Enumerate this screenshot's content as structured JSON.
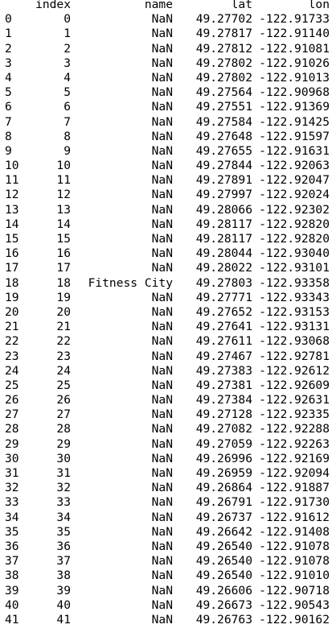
{
  "columns": [
    "index",
    "name",
    "lat",
    "lon"
  ],
  "rows": [
    [
      "0",
      "0",
      "NaN",
      "49.27702",
      "-122.91733"
    ],
    [
      "1",
      "1",
      "NaN",
      "49.27817",
      "-122.91140"
    ],
    [
      "2",
      "2",
      "NaN",
      "49.27812",
      "-122.91081"
    ],
    [
      "3",
      "3",
      "NaN",
      "49.27802",
      "-122.91026"
    ],
    [
      "4",
      "4",
      "NaN",
      "49.27802",
      "-122.91013"
    ],
    [
      "5",
      "5",
      "NaN",
      "49.27564",
      "-122.90968"
    ],
    [
      "6",
      "6",
      "NaN",
      "49.27551",
      "-122.91369"
    ],
    [
      "7",
      "7",
      "NaN",
      "49.27584",
      "-122.91425"
    ],
    [
      "8",
      "8",
      "NaN",
      "49.27648",
      "-122.91597"
    ],
    [
      "9",
      "9",
      "NaN",
      "49.27655",
      "-122.91631"
    ],
    [
      "10",
      "10",
      "NaN",
      "49.27844",
      "-122.92063"
    ],
    [
      "11",
      "11",
      "NaN",
      "49.27891",
      "-122.92047"
    ],
    [
      "12",
      "12",
      "NaN",
      "49.27997",
      "-122.92024"
    ],
    [
      "13",
      "13",
      "NaN",
      "49.28066",
      "-122.92302"
    ],
    [
      "14",
      "14",
      "NaN",
      "49.28117",
      "-122.92820"
    ],
    [
      "15",
      "15",
      "NaN",
      "49.28117",
      "-122.92820"
    ],
    [
      "16",
      "16",
      "NaN",
      "49.28044",
      "-122.93040"
    ],
    [
      "17",
      "17",
      "NaN",
      "49.28022",
      "-122.93101"
    ],
    [
      "18",
      "18",
      "Fitness City",
      "49.27803",
      "-122.93358"
    ],
    [
      "19",
      "19",
      "NaN",
      "49.27771",
      "-122.93343"
    ],
    [
      "20",
      "20",
      "NaN",
      "49.27652",
      "-122.93153"
    ],
    [
      "21",
      "21",
      "NaN",
      "49.27641",
      "-122.93131"
    ],
    [
      "22",
      "22",
      "NaN",
      "49.27611",
      "-122.93068"
    ],
    [
      "23",
      "23",
      "NaN",
      "49.27467",
      "-122.92781"
    ],
    [
      "24",
      "24",
      "NaN",
      "49.27383",
      "-122.92612"
    ],
    [
      "25",
      "25",
      "NaN",
      "49.27381",
      "-122.92609"
    ],
    [
      "26",
      "26",
      "NaN",
      "49.27384",
      "-122.92631"
    ],
    [
      "27",
      "27",
      "NaN",
      "49.27128",
      "-122.92335"
    ],
    [
      "28",
      "28",
      "NaN",
      "49.27082",
      "-122.92288"
    ],
    [
      "29",
      "29",
      "NaN",
      "49.27059",
      "-122.92263"
    ],
    [
      "30",
      "30",
      "NaN",
      "49.26996",
      "-122.92169"
    ],
    [
      "31",
      "31",
      "NaN",
      "49.26959",
      "-122.92094"
    ],
    [
      "32",
      "32",
      "NaN",
      "49.26864",
      "-122.91887"
    ],
    [
      "33",
      "33",
      "NaN",
      "49.26791",
      "-122.91730"
    ],
    [
      "34",
      "34",
      "NaN",
      "49.26737",
      "-122.91612"
    ],
    [
      "35",
      "35",
      "NaN",
      "49.26642",
      "-122.91408"
    ],
    [
      "36",
      "36",
      "NaN",
      "49.26540",
      "-122.91078"
    ],
    [
      "37",
      "37",
      "NaN",
      "49.26540",
      "-122.91078"
    ],
    [
      "38",
      "38",
      "NaN",
      "49.26540",
      "-122.91010"
    ],
    [
      "39",
      "39",
      "NaN",
      "49.26606",
      "-122.90718"
    ],
    [
      "40",
      "40",
      "NaN",
      "49.26673",
      "-122.90543"
    ],
    [
      "41",
      "41",
      "NaN",
      "49.26763",
      "-122.90162"
    ]
  ]
}
